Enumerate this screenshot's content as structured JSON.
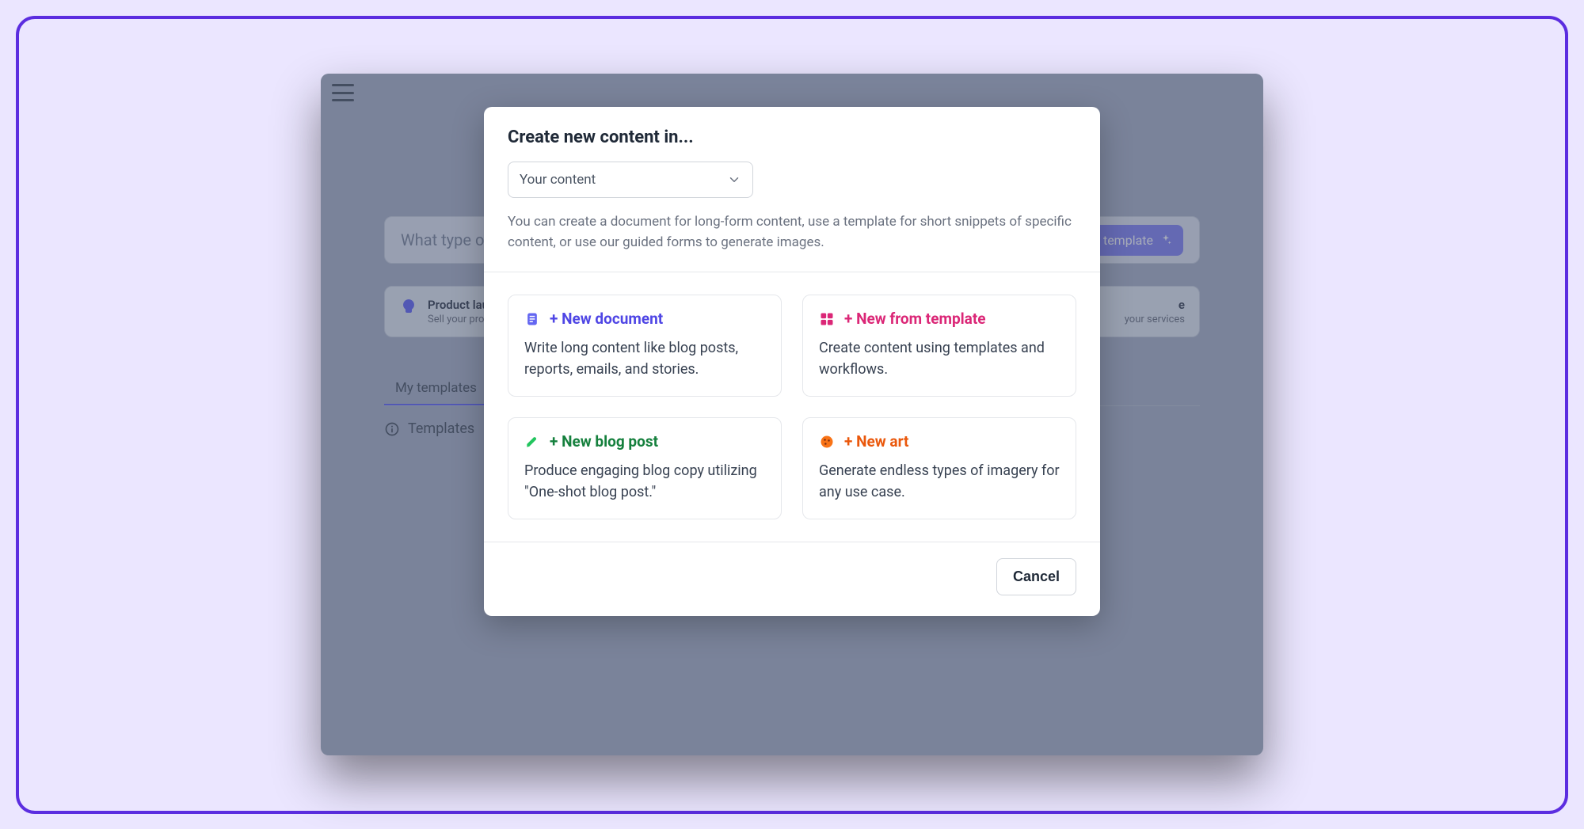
{
  "background": {
    "search_placeholder": "What type of",
    "template_button": "template",
    "card_left": {
      "title": "Product lau",
      "subtitle": "Sell your produ"
    },
    "card_right": {
      "title": "e",
      "subtitle": "your services"
    },
    "tab_label": "My templates",
    "info_label": "Templates"
  },
  "modal": {
    "title": "Create new content in...",
    "select_value": "Your content",
    "description": "You can create a document for long-form content, use a template for short snippets of specific content, or use our guided forms to generate images.",
    "options": [
      {
        "key": "new-document",
        "icon": "document-icon",
        "color": "blue",
        "title": "+ New document",
        "desc": "Write long content like blog posts, reports, emails, and stories."
      },
      {
        "key": "new-template",
        "icon": "grid-icon",
        "color": "pink",
        "title": "+ New from template",
        "desc": "Create content using templates and workflows."
      },
      {
        "key": "new-blog",
        "icon": "pen-icon",
        "color": "green",
        "title": "+ New blog post",
        "desc": "Produce engaging blog copy utilizing \"One-shot blog post.\""
      },
      {
        "key": "new-art",
        "icon": "palette-icon",
        "color": "orange",
        "title": "+ New art",
        "desc": "Generate endless types of imagery for any use case."
      }
    ],
    "cancel": "Cancel"
  }
}
